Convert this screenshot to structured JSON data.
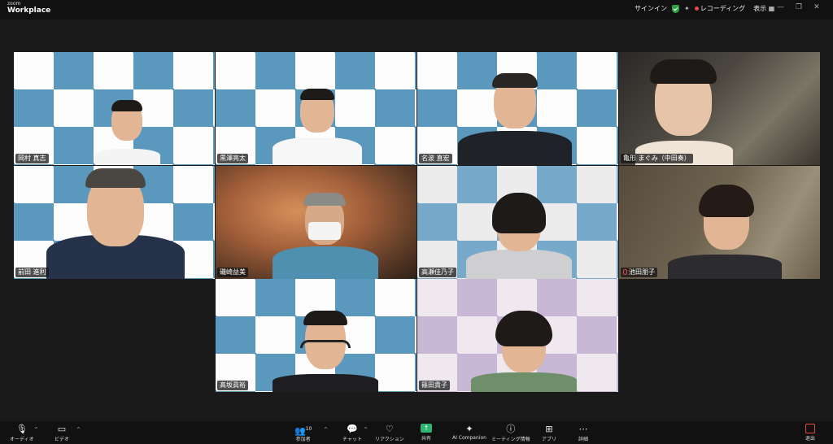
{
  "app": {
    "brand_small": "zoom",
    "brand_big": "Workplace"
  },
  "titlebar": {
    "signin": "サインイン",
    "recording": "レコーディング",
    "view": "表示"
  },
  "participants": [
    {
      "name": "岡村 真志"
    },
    {
      "name": "黒澤亮太"
    },
    {
      "name": "名波 直宏"
    },
    {
      "name": "亀形 まぐみ（中田奏）"
    },
    {
      "name": "前田 進利"
    },
    {
      "name": "磯崎益美"
    },
    {
      "name": "高瀬佳乃子"
    },
    {
      "name": "池田朋子"
    },
    {
      "name": "髙坂眞裕"
    },
    {
      "name": "篠田貴子"
    }
  ],
  "toolbar": {
    "audio": "オーディオ",
    "video": "ビデオ",
    "participants": "参加者",
    "participant_count": "10",
    "chat": "チャット",
    "reaction": "リアクション",
    "share": "共有",
    "ai": "AI Companion",
    "info": "ミーティング情報",
    "apps": "アプリ",
    "more": "詳細",
    "leave": "退出"
  },
  "colors": {
    "active_border": "#4ac96e",
    "share": "#2bb673",
    "leave": "#e5484d"
  }
}
